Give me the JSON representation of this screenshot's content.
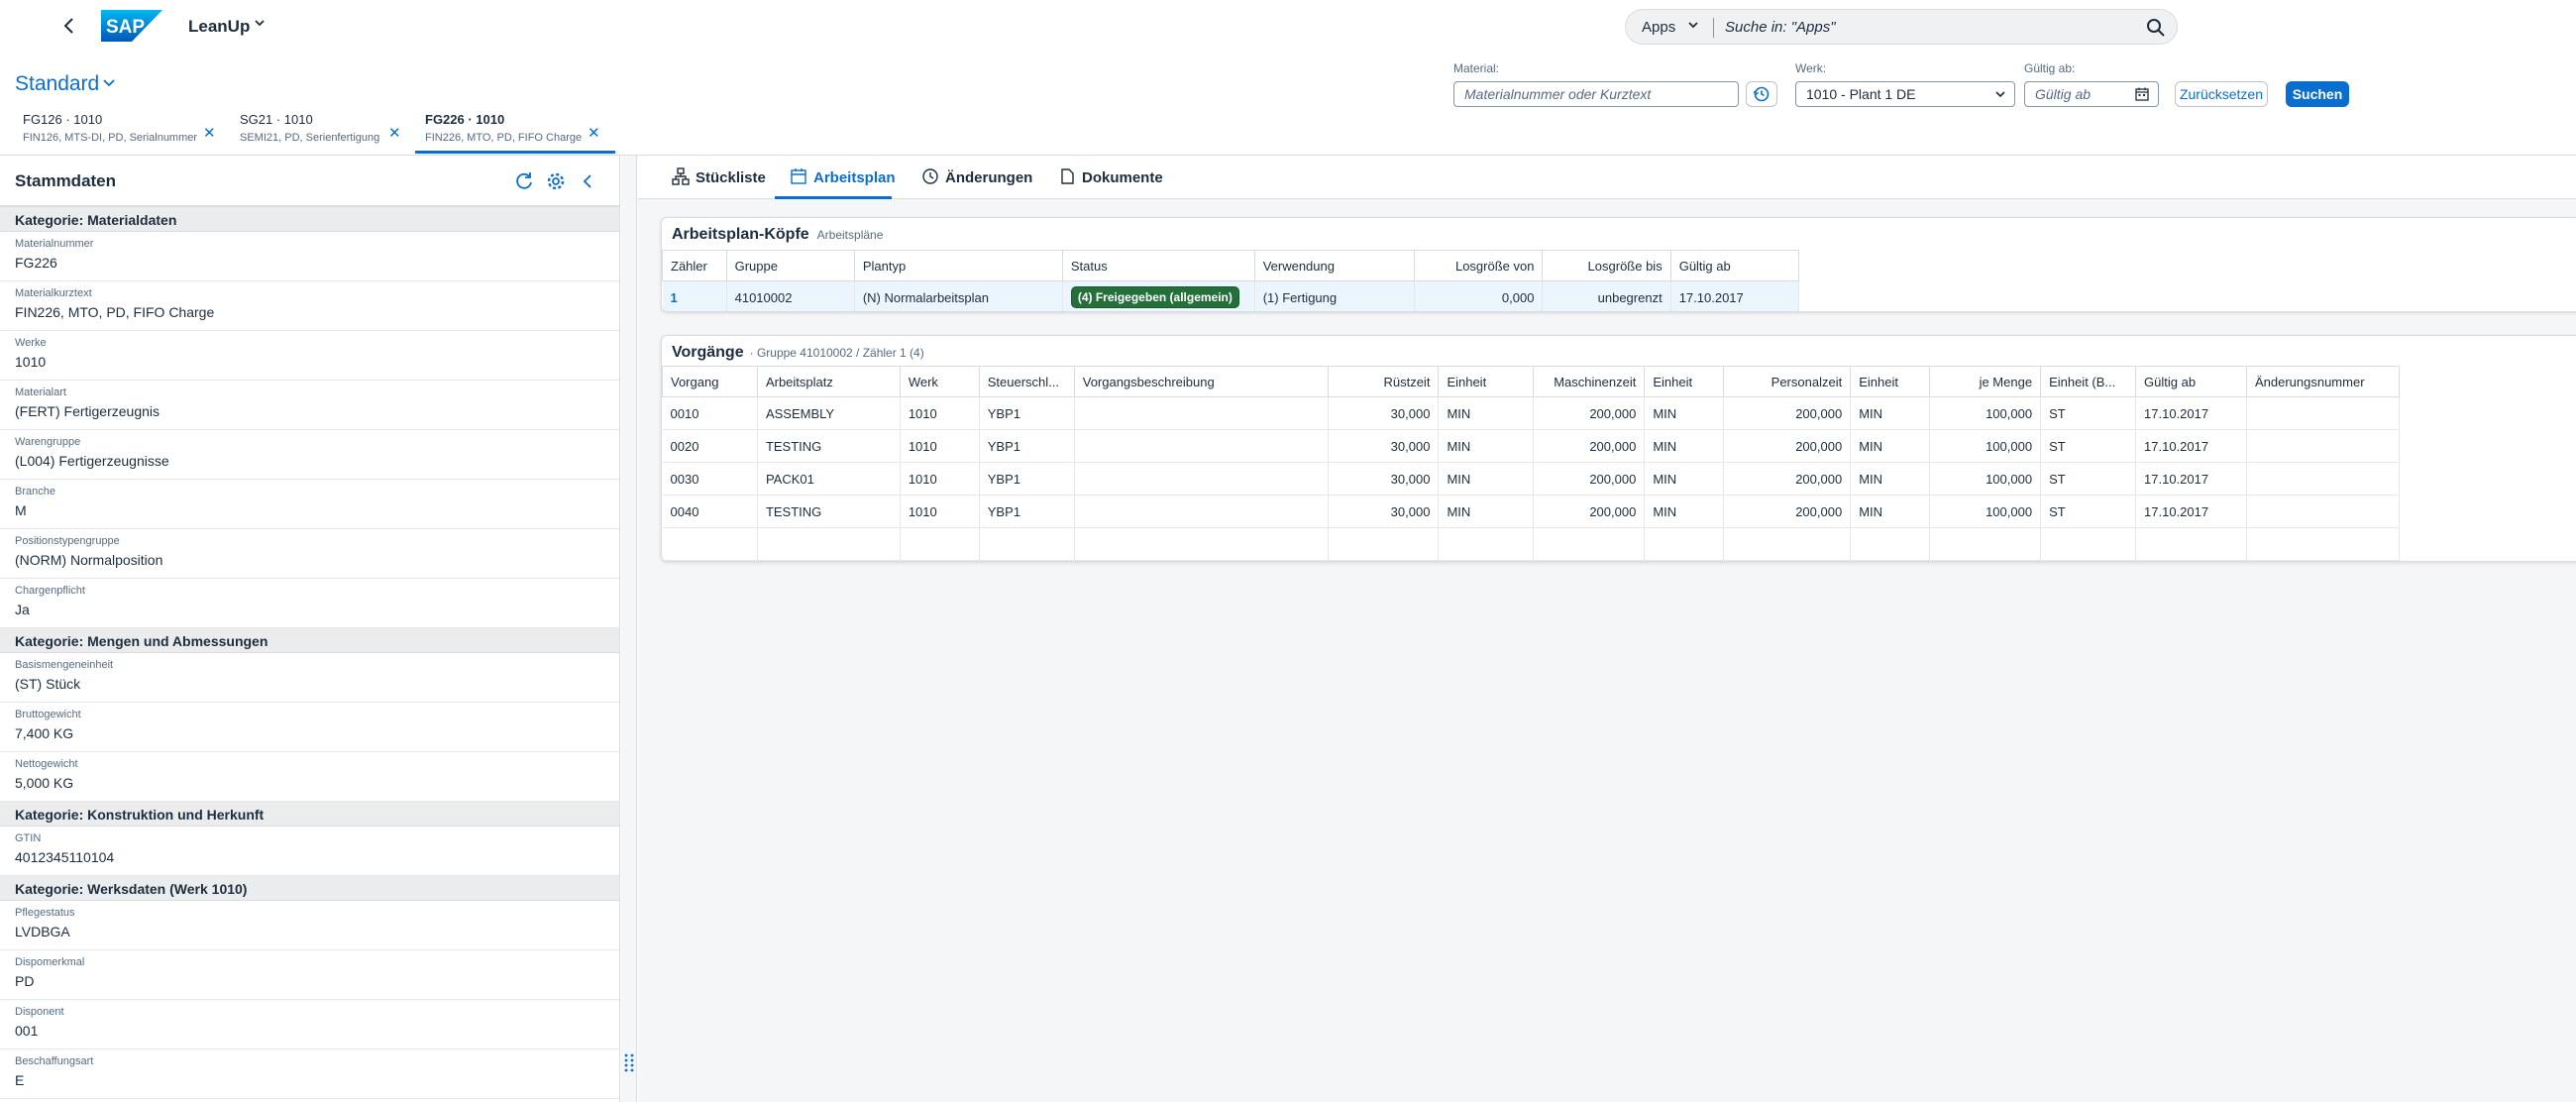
{
  "shell": {
    "app_title": "LeanUp",
    "logo_text": "SAP",
    "search_scope": "Apps",
    "search_placeholder": "Suche in: \"Apps\""
  },
  "header": {
    "variant": "Standard",
    "filters": {
      "material_label": "Material:",
      "material_placeholder": "Materialnummer oder Kurztext",
      "werk_label": "Werk:",
      "werk_value": "1010 - Plant 1 DE",
      "gueltig_label": "Gültig ab:",
      "gueltig_placeholder": "Gültig ab",
      "reset_label": "Zurücksetzen",
      "search_label": "Suchen"
    }
  },
  "material_tabs": [
    {
      "title": "FG126 · 1010",
      "sub": "FIN126, MTS-DI, PD, Serialnummer"
    },
    {
      "title": "SG21 · 1010",
      "sub": "SEMI21, PD, Serienfertigung"
    },
    {
      "title": "FG226 · 1010",
      "sub": "FIN226, MTO, PD, FIFO Charge"
    }
  ],
  "stammdaten": {
    "title": "Stammdaten",
    "cat1": "Kategorie: Materialdaten",
    "f1": {
      "label": "Materialnummer",
      "value": "FG226"
    },
    "f2": {
      "label": "Materialkurztext",
      "value": "FIN226, MTO, PD, FIFO Charge"
    },
    "f3": {
      "label": "Werke",
      "value": "1010"
    },
    "f4": {
      "label": "Materialart",
      "value": "(FERT) Fertigerzeugnis"
    },
    "f5": {
      "label": "Warengruppe",
      "value": "(L004) Fertigerzeugnisse"
    },
    "f6": {
      "label": "Branche",
      "value": "M"
    },
    "f7": {
      "label": "Positionstypengruppe",
      "value": "(NORM) Normalposition"
    },
    "f8": {
      "label": "Chargenpflicht",
      "value": "Ja"
    },
    "cat2": "Kategorie: Mengen und Abmessungen",
    "f9": {
      "label": "Basismengeneinheit",
      "value": "(ST) Stück"
    },
    "f10": {
      "label": "Bruttogewicht",
      "value": "7,400 KG"
    },
    "f11": {
      "label": "Nettogewicht",
      "value": "5,000 KG"
    },
    "cat3": "Kategorie: Konstruktion und Herkunft",
    "f12": {
      "label": "GTIN",
      "value": "4012345110104"
    },
    "cat4": "Kategorie: Werksdaten (Werk 1010)",
    "f13": {
      "label": "Pflegestatus",
      "value": "LVDBGA"
    },
    "f14": {
      "label": "Dispomerkmal",
      "value": "PD"
    },
    "f15": {
      "label": "Disponent",
      "value": "001"
    },
    "f16": {
      "label": "Beschaffungsart",
      "value": "E"
    }
  },
  "content_tabs": [
    "Stückliste",
    "Arbeitsplan",
    "Änderungen",
    "Dokumente"
  ],
  "koepfe": {
    "title": "Arbeitsplan-Köpfe",
    "subtitle": "Arbeitspläne",
    "columns": [
      "Zähler",
      "Gruppe",
      "Plantyp",
      "Status",
      "Verwendung",
      "Losgröße von",
      "Losgröße bis",
      "Gültig ab"
    ],
    "row": {
      "zaehler": "1",
      "gruppe": "41010002",
      "plantyp": "(N) Normalarbeitsplan",
      "status": "(4) Freigegeben (allgemein)",
      "verwendung": "(1) Fertigung",
      "von": "0,000",
      "bis": "unbegrenzt",
      "gueltig": "17.10.2017"
    }
  },
  "vorgaenge": {
    "title": "Vorgänge",
    "subtitle": "· Gruppe 41010002 / Zähler 1 (4)",
    "columns": [
      "Vorgang",
      "Arbeitsplatz",
      "Werk",
      "Steuerschl...",
      "Vorgangsbeschreibung",
      "Rüstzeit",
      "Einheit",
      "Maschinenzeit",
      "Einheit",
      "Personalzeit",
      "Einheit",
      "je Menge",
      "Einheit (B...",
      "Gültig ab",
      "Änderungsnummer"
    ],
    "rows": [
      [
        "0010",
        "ASSEMBLY",
        "1010",
        "YBP1",
        "",
        "30,000",
        "MIN",
        "200,000",
        "MIN",
        "200,000",
        "MIN",
        "100,000",
        "ST",
        "17.10.2017",
        ""
      ],
      [
        "0020",
        "TESTING",
        "1010",
        "YBP1",
        "",
        "30,000",
        "MIN",
        "200,000",
        "MIN",
        "200,000",
        "MIN",
        "100,000",
        "ST",
        "17.10.2017",
        ""
      ],
      [
        "0030",
        "PACK01",
        "1010",
        "YBP1",
        "",
        "30,000",
        "MIN",
        "200,000",
        "MIN",
        "200,000",
        "MIN",
        "100,000",
        "ST",
        "17.10.2017",
        ""
      ],
      [
        "0040",
        "TESTING",
        "1010",
        "YBP1",
        "",
        "30,000",
        "MIN",
        "200,000",
        "MIN",
        "200,000",
        "MIN",
        "100,000",
        "ST",
        "17.10.2017",
        ""
      ]
    ]
  },
  "colors": {
    "accent": "#0a6ed1",
    "status_positive": "#256f3a"
  }
}
